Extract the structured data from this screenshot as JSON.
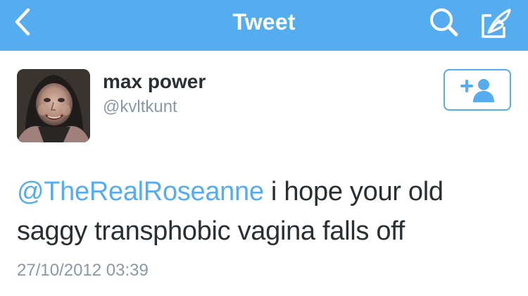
{
  "colors": {
    "nav_background": "#55acee",
    "accent": "#55acee",
    "text_primary": "#292f33",
    "text_secondary": "#8899a6"
  },
  "navbar": {
    "title": "Tweet",
    "back_icon": "chevron-left-icon",
    "search_icon": "search-icon",
    "compose_icon": "compose-quill-icon"
  },
  "tweet": {
    "author": {
      "name": "max power",
      "handle": "@kvltkunt"
    },
    "follow_button_icon": "add-user-icon",
    "follow_button_label": "+",
    "mention": "@TheRealRoseanne",
    "body": " i hope your old saggy transphobic vagina falls off",
    "timestamp": "27/10/2012 03:39"
  }
}
